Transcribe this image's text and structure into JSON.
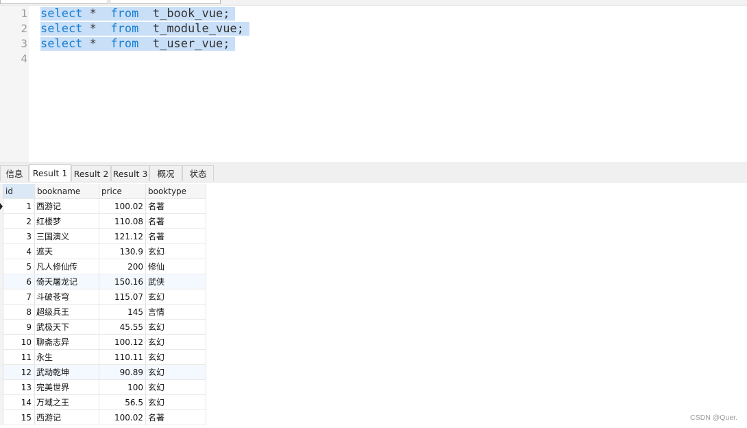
{
  "editor": {
    "lines": [
      {
        "num": "1",
        "kw1": "select",
        "star": "*",
        "kw2": "from",
        "table": "t_book_vue;"
      },
      {
        "num": "2",
        "kw1": "select",
        "star": "*",
        "kw2": "from",
        "table": "t_module_vue;"
      },
      {
        "num": "3",
        "kw1": "select",
        "star": "*",
        "kw2": "from",
        "table": "t_user_vue;"
      },
      {
        "num": "4"
      }
    ]
  },
  "tabs": [
    {
      "label": "信息",
      "active": false
    },
    {
      "label": "Result 1",
      "active": true
    },
    {
      "label": "Result 2",
      "active": false
    },
    {
      "label": "Result 3",
      "active": false
    },
    {
      "label": "概况",
      "active": false
    },
    {
      "label": "状态",
      "active": false
    }
  ],
  "grid": {
    "columns": [
      "id",
      "bookname",
      "price",
      "booktype"
    ],
    "rows": [
      [
        "1",
        "西游记",
        "100.02",
        "名著"
      ],
      [
        "2",
        "红楼梦",
        "110.08",
        "名著"
      ],
      [
        "3",
        "三国演义",
        "121.12",
        "名著"
      ],
      [
        "4",
        "遮天",
        "130.9",
        "玄幻"
      ],
      [
        "5",
        "凡人修仙传",
        "200",
        "修仙"
      ],
      [
        "6",
        "倚天屠龙记",
        "150.16",
        "武侠"
      ],
      [
        "7",
        "斗破苍穹",
        "115.07",
        "玄幻"
      ],
      [
        "8",
        "超级兵王",
        "145",
        "言情"
      ],
      [
        "9",
        "武极天下",
        "45.55",
        "玄幻"
      ],
      [
        "10",
        "聊斋志异",
        "100.12",
        "玄幻"
      ],
      [
        "11",
        "永生",
        "110.11",
        "玄幻"
      ],
      [
        "12",
        "武动乾坤",
        "90.89",
        "玄幻"
      ],
      [
        "13",
        "完美世界",
        "100",
        "玄幻"
      ],
      [
        "14",
        "万域之王",
        "56.5",
        "玄幻"
      ],
      [
        "15",
        "西游记",
        "100.02",
        "名著"
      ]
    ]
  },
  "watermark": "CSDN @Quer.",
  "colors": {
    "keyword": "#1a7fd4",
    "selection": "#c8dff7",
    "header_id": "#dbe9f7"
  }
}
